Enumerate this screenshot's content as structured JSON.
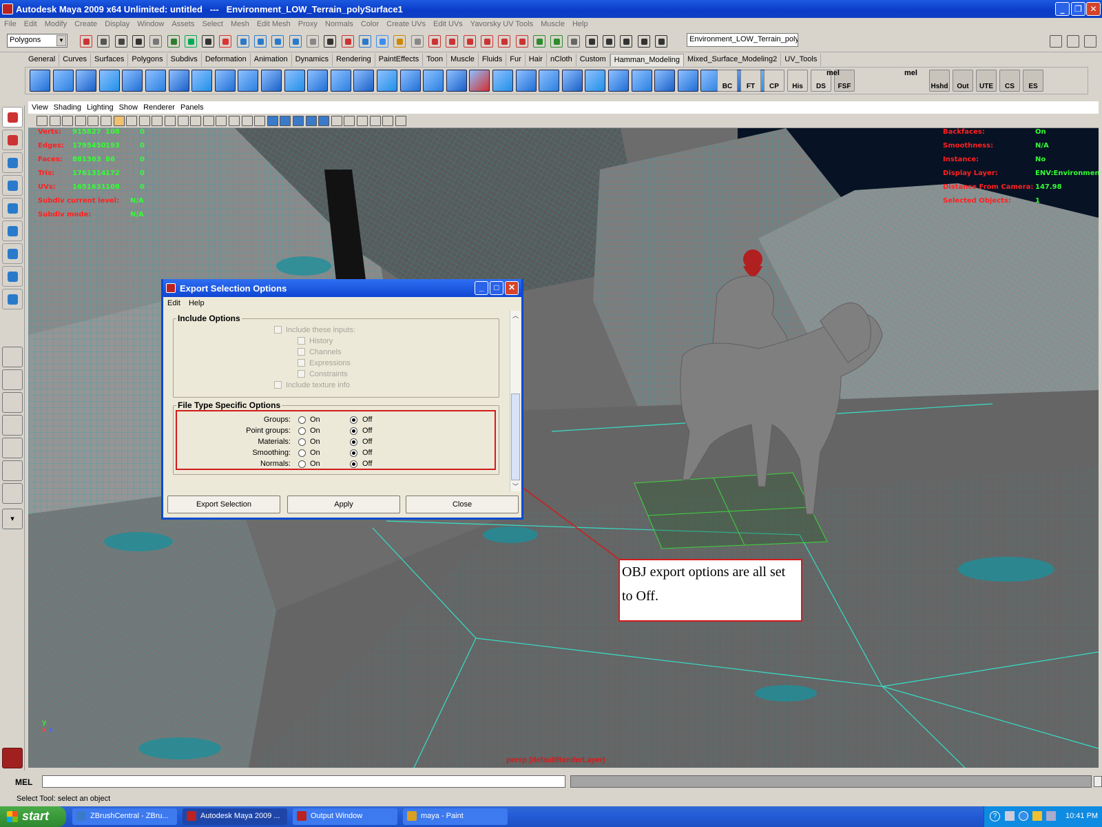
{
  "window": {
    "title": "Autodesk Maya 2009 x64 Unlimited: untitled   ---   Environment_LOW_Terrain_polySurface1"
  },
  "menubar": [
    "File",
    "Edit",
    "Modify",
    "Create",
    "Display",
    "Window",
    "Assets",
    "Select",
    "Mesh",
    "Edit Mesh",
    "Proxy",
    "Normals",
    "Color",
    "Create UVs",
    "Edit UVs",
    "Yavorsky UV Tools",
    "Muscle",
    "Help"
  ],
  "status_line": {
    "mode": "Polygons",
    "object_field": "Environment_LOW_Terrain_polyS"
  },
  "shelf_tabs": [
    "General",
    "Curves",
    "Surfaces",
    "Polygons",
    "Subdivs",
    "Deformation",
    "Animation",
    "Dynamics",
    "Rendering",
    "PaintEffects",
    "Toon",
    "Muscle",
    "Fluids",
    "Fur",
    "Hair",
    "nCloth",
    "Custom",
    "Hamman_Modeling",
    "Mixed_Surface_Modeling2",
    "UV_Tools"
  ],
  "shelf_active_tab": "Hamman_Modeling",
  "shelf_labels": [
    "BC",
    "FT",
    "CP",
    "His",
    "DS",
    "FSF",
    "Hshd",
    "Out",
    "UTE",
    "CS",
    "ES"
  ],
  "shelf_mel": [
    "mel",
    "mel"
  ],
  "viewport_menu": [
    "View",
    "Shading",
    "Lighting",
    "Show",
    "Renderer",
    "Panels"
  ],
  "hud_left": [
    {
      "label": "Verts:",
      "v1": "915827",
      "v2": "108",
      "v3": "0"
    },
    {
      "label": "Edges:",
      "v1": "1795450",
      "v2": "193",
      "v3": "0"
    },
    {
      "label": "Faces:",
      "v1": "881363",
      "v2": "86",
      "v3": "0"
    },
    {
      "label": "Tris:",
      "v1": "1761314",
      "v2": "172",
      "v3": "0"
    },
    {
      "label": "UVs:",
      "v1": "1651631",
      "v2": "108",
      "v3": "0"
    },
    {
      "label": "Subdiv current level:",
      "v1": "N/A"
    },
    {
      "label": "Subdiv mode:",
      "v1": "N/A"
    }
  ],
  "hud_right": [
    {
      "label": "Backfaces:",
      "value": "On"
    },
    {
      "label": "Smoothness:",
      "value": "N/A"
    },
    {
      "label": "Instance:",
      "value": "No"
    },
    {
      "label": "Display Layer:",
      "value": "ENV:Environmen"
    },
    {
      "label": "Distance From Camera:",
      "value": "147.98"
    },
    {
      "label": "Selected Objects:",
      "value": "1"
    }
  ],
  "camera_label": "persp (defaultRenderLayer)",
  "axis": {
    "y": "y",
    "x": "x",
    "z": "z"
  },
  "dialog": {
    "title": "Export Selection Options",
    "menu": [
      "Edit",
      "Help"
    ],
    "include_group": {
      "title": "Include Options",
      "items": [
        {
          "label": "Include these inputs:",
          "indent": 0
        },
        {
          "label": "History",
          "indent": 1
        },
        {
          "label": "Channels",
          "indent": 1
        },
        {
          "label": "Expressions",
          "indent": 1
        },
        {
          "label": "Constraints",
          "indent": 1
        },
        {
          "label": "Include texture info",
          "indent": 0
        }
      ]
    },
    "filetype_group": {
      "title": "File Type Specific Options",
      "on_label": "On",
      "off_label": "Off",
      "rows": [
        {
          "label": "Groups:",
          "selected": "Off"
        },
        {
          "label": "Point groups:",
          "selected": "Off"
        },
        {
          "label": "Materials:",
          "selected": "Off"
        },
        {
          "label": "Smoothing:",
          "selected": "Off"
        },
        {
          "label": "Normals:",
          "selected": "Off"
        }
      ]
    },
    "buttons": {
      "export": "Export Selection",
      "apply": "Apply",
      "close": "Close"
    }
  },
  "annotation": {
    "text": "OBJ export options are all set to Off.",
    "color": "#d21b1b"
  },
  "command_line": {
    "label": "MEL",
    "help": "Select Tool: select an object"
  },
  "taskbar": {
    "start": "start",
    "tasks": [
      {
        "label": "ZBrushCentral - ZBru...",
        "active": false
      },
      {
        "label": "Autodesk Maya 2009 ...",
        "active": true
      },
      {
        "label": "Output Window",
        "active": false
      },
      {
        "label": "maya - Paint",
        "active": false
      }
    ],
    "clock": "10:41 PM"
  },
  "colors": {
    "accent": "#0b4bd0",
    "wireframe": "#1ea8b4",
    "hud_label": "#ff2020",
    "hud_value": "#34ff34"
  }
}
